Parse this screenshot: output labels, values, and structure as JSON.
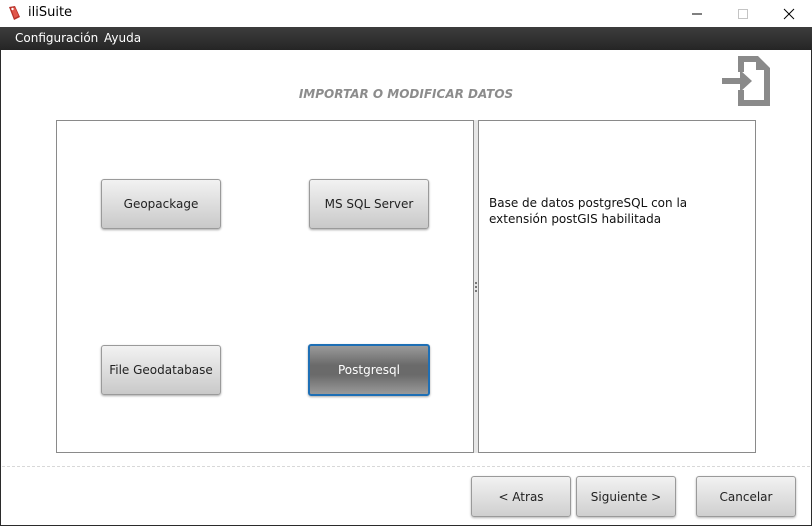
{
  "window": {
    "title": "iliSuite",
    "app_icon": "ilisuite-logo-icon",
    "controls": {
      "minimize": "minimize-icon",
      "maximize": "maximize-icon",
      "close": "close-icon"
    }
  },
  "menubar": {
    "items": [
      {
        "label": "Configuración"
      },
      {
        "label": "Ayuda"
      }
    ]
  },
  "page": {
    "heading": "IMPORTAR O MODIFICAR DATOS",
    "heading_icon": "import-icon"
  },
  "datasources": [
    {
      "label": "Geopackage",
      "selected": false
    },
    {
      "label": "MS SQL Server",
      "selected": false
    },
    {
      "label": "File Geodatabase",
      "selected": false
    },
    {
      "label": "Postgresql",
      "selected": true
    }
  ],
  "description": {
    "line1": "Base de datos postgreSQL con la",
    "line2": "extensión postGIS habilitada"
  },
  "footer": {
    "back": "< Atras",
    "next": "Siguiente >",
    "cancel": "Cancelar"
  },
  "colors": {
    "menubar": "#2f2f2f",
    "selection_border": "#1e6fb5",
    "heading": "#8c8c8c",
    "app_icon": "#c0392b"
  }
}
